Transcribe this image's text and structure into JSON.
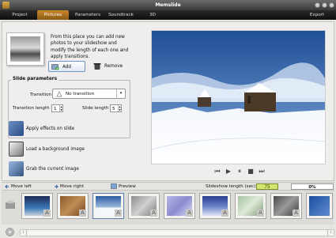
{
  "window": {
    "title": "Memslide"
  },
  "menu": [
    "Project",
    "Pictures",
    "Parameters",
    "Soundtrack",
    "3D",
    "Export"
  ],
  "pictures_panel": {
    "intro": "From this place you can add new photos to your slideshow and modify the length of each one and apply transitions.",
    "add_label": "Add",
    "remove_label": "Remove"
  },
  "slide_parameters": {
    "title": "Slide parameters",
    "transition_label": "Transition",
    "transition_value": "No transition",
    "transition_length_label": "Transition length",
    "transition_length_value": "1",
    "slide_length_label": "Slide length",
    "slide_length_value": "5"
  },
  "actions": {
    "apply_effects": "Apply effects on slide",
    "load_background": "Load a background image",
    "grab_image": "Grab the current image"
  },
  "bottom_bar": {
    "move_left": "Move left",
    "move_right": "Move right",
    "preview": "Preview",
    "slideshow_length_label": "Slideshow length (sec)",
    "slideshow_length_value": "75",
    "progress_text": "0%",
    "progress_value": 0
  },
  "timeline": {
    "frame_badge": "A"
  }
}
